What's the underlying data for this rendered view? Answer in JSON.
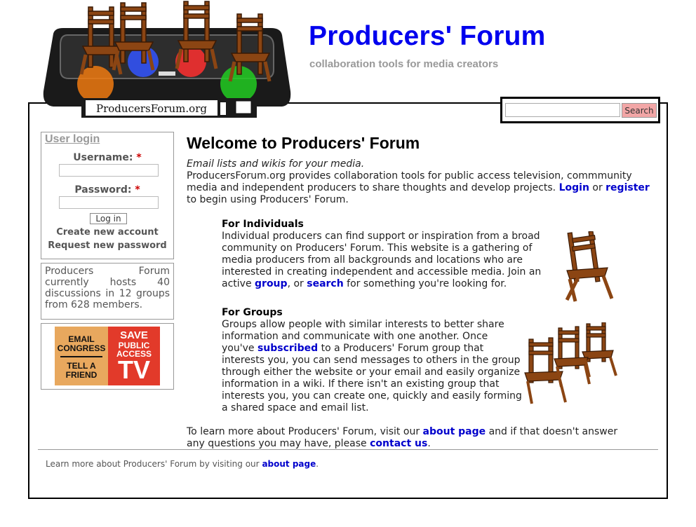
{
  "header": {
    "site_name": "Producers' Forum",
    "slogan": "collaboration tools for media creators",
    "logo_text": "ProducersForum.org"
  },
  "search": {
    "placeholder": "",
    "button_label": "Search"
  },
  "login": {
    "title": "User login",
    "username_label": "Username:",
    "password_label": "Password:",
    "required_mark": "*",
    "button_label": "Log in",
    "create_account": "Create new account",
    "request_password": "Request new password"
  },
  "stats": {
    "text": "Producers Forum currently hosts 40 discussions in 12 groups from 628 members."
  },
  "banner": {
    "left_line1": "EMAIL",
    "left_line2": "CONGRESS",
    "left_line3": "TELL A",
    "left_line4": "FRIEND",
    "right_line1": "SAVE",
    "right_line2": "PUBLIC",
    "right_line3": "ACCESS",
    "right_line4": "TV"
  },
  "main": {
    "title": "Welcome to Producers' Forum",
    "tagline": "Email lists and wikis for your media.",
    "intro_text": "ProducersForum.org provides collaboration tools for public access television, commmunity media and independent producers to share thoughts and develop projects.",
    "login_link": "Login",
    "or_text": "or",
    "register_link": "register",
    "intro_end": "to begin using Producers' Forum."
  },
  "individuals": {
    "heading": "For Individuals",
    "text": "Individual producers can find support or inspiration from a broad community on Producers' Forum. This website is a gathering of media producers from all backgrounds and locations who are interested in creating independent and accessible media. Join an active",
    "group_link": "group",
    "or_text": ", or",
    "search_link": "search",
    "text_end": "for something you're looking for."
  },
  "groups": {
    "heading": "For Groups",
    "text": "Groups allow people with similar interests to better share information and communicate with one another. Once you've",
    "subscribed_link": "subscribed",
    "text_end": "to a Producers' Forum group that interests you, you can send messages to others in the group through either the website or your email and easily organize information in a wiki. If there isn't an existing group that interests you, you can create one, quickly and easily forming a shared space and email list."
  },
  "outro": {
    "text": "To learn more about Producers' Forum, visit our",
    "about_link": "about page",
    "text_mid": "and if that doesn't answer any questions you may have, please",
    "contact_link": "contact us",
    "text_end": "."
  },
  "footer": {
    "text": "Learn more about Producers' Forum by visiting our",
    "about_link": "about page",
    "text_end": "."
  },
  "colors": {
    "site_name": "#0000ee",
    "link": "#0000cc",
    "search_button": "#f2a6a6",
    "chair": "#8b4513",
    "required": "#cc0000"
  }
}
